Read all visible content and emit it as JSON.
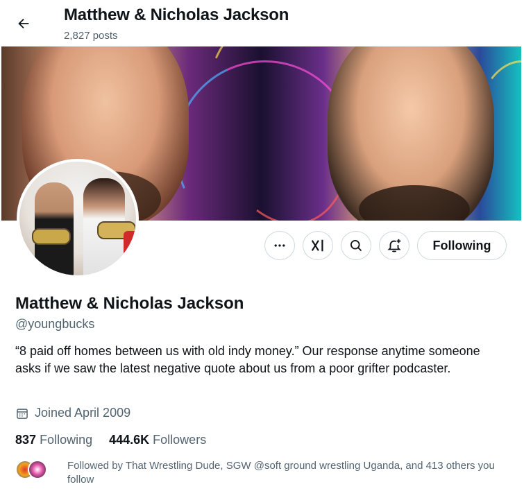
{
  "header": {
    "title": "Matthew & Nicholas Jackson",
    "posts": "2,827 posts"
  },
  "icons": {
    "back": "arrow-left-icon",
    "more": "ellipsis-icon",
    "grok": "grok-icon",
    "search": "search-icon",
    "notify": "bell-plus-icon",
    "calendar": "calendar-icon"
  },
  "actions": {
    "following_label": "Following"
  },
  "profile": {
    "name": "Matthew & Nicholas Jackson",
    "handle": "@youngbucks",
    "bio": "“8 paid off homes between us with old indy money.” Our response anytime someone asks if we saw the latest negative quote about us from a poor grifter podcaster.",
    "joined": "Joined April 2009",
    "following_count": "837",
    "following_label": "Following",
    "followers_count": "444.6K",
    "followers_label": "Followers",
    "followed_by": "Followed by That Wrestling Dude, SGW @soft ground wrestling Uganda, and 413 others you follow"
  },
  "colors": {
    "text_primary": "#0f1419",
    "text_secondary": "#536471",
    "border": "#cfd9de"
  }
}
